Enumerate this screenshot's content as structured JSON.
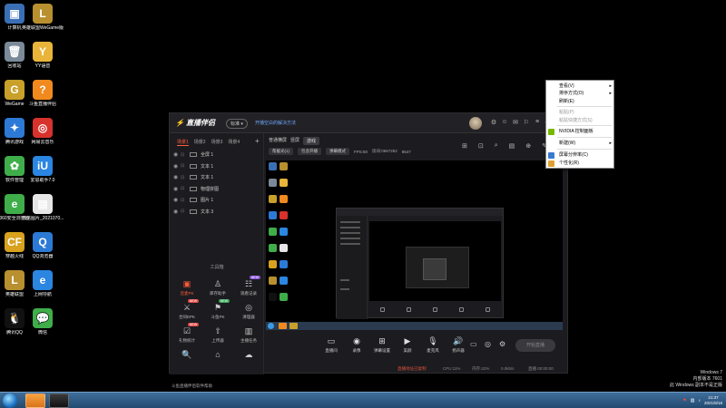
{
  "desktop": {
    "icons": [
      {
        "label": "计算机",
        "color": "#3b6fb5",
        "glyph": "▣"
      },
      {
        "label": "英雄联盟WeGame版",
        "color": "#b8902f",
        "glyph": "L"
      },
      {
        "label": "回收站",
        "color": "#7a8a99",
        "glyph": "🗑"
      },
      {
        "label": "YY语音",
        "color": "#e8b43a",
        "glyph": "Y"
      },
      {
        "label": "WeGame",
        "color": "#c8a02a",
        "glyph": "G"
      },
      {
        "label": "斗鱼直播伴侣",
        "color": "#f08a1e",
        "glyph": "?"
      },
      {
        "label": "腾讯游戏",
        "color": "#2d7ad6",
        "glyph": "✦"
      },
      {
        "label": "网易云音乐",
        "color": "#d8322c",
        "glyph": "◎"
      },
      {
        "label": "软件管理",
        "color": "#3fae4a",
        "glyph": "✿"
      },
      {
        "label": "爱思助手7.0",
        "color": "#2a86e0",
        "glyph": "iU"
      },
      {
        "label": "360安全浏览器",
        "color": "#3fae4a",
        "glyph": "e"
      },
      {
        "label": "微信图片_2021070...",
        "color": "#e6e6e6",
        "glyph": "▤"
      },
      {
        "label": "穿越火线",
        "color": "#d8a21e",
        "glyph": "CF"
      },
      {
        "label": "QQ浏览器",
        "color": "#2d7ad6",
        "glyph": "Q"
      },
      {
        "label": "英雄联盟",
        "color": "#b8902f",
        "glyph": "L"
      },
      {
        "label": "上网导航",
        "color": "#2a86e0",
        "glyph": "e"
      },
      {
        "label": "腾讯QQ",
        "color": "#111111",
        "glyph": "🐧"
      },
      {
        "label": "微信",
        "color": "#3fae4a",
        "glyph": "💬"
      }
    ]
  },
  "app": {
    "logo": "直播伴侣",
    "version": "标准 ▾",
    "notice": "开播空白的解决方法",
    "title_buttons": [
      "⚙",
      "☺",
      "✉",
      "⚐",
      "≡",
      "—",
      "✕"
    ],
    "scene_tabs": [
      "场景1",
      "场景2",
      "场景3",
      "场景4"
    ],
    "scene_add": "+",
    "sources": [
      {
        "name": "全屏 1"
      },
      {
        "name": "文本 1"
      },
      {
        "name": "文本 1"
      },
      {
        "name": "物理拼图"
      },
      {
        "name": "图片 1"
      },
      {
        "name": "文本 3"
      }
    ],
    "tools_title": "工具箱",
    "tools": [
      {
        "label": "连麦PK",
        "glyph": "▣",
        "hot": true,
        "badge": ""
      },
      {
        "label": "库存助手",
        "glyph": "♙",
        "hot": false,
        "badge": ""
      },
      {
        "label": "观看记录",
        "glyph": "☷",
        "hot": false,
        "badge": "NEW"
      },
      {
        "label": "合同EPK",
        "glyph": "⚔",
        "hot": false,
        "badge": "NEW"
      },
      {
        "label": "斗鱼PK",
        "glyph": "⚑",
        "hot": false,
        "badge": "NEW"
      },
      {
        "label": "清理器",
        "glyph": "◎",
        "hot": false,
        "badge": ""
      },
      {
        "label": "礼物统计",
        "glyph": "☑",
        "hot": false,
        "badge": "NEW"
      },
      {
        "label": "上传器",
        "glyph": "⇧",
        "hot": false,
        "badge": ""
      },
      {
        "label": "主播任务",
        "glyph": "▥",
        "hot": false,
        "badge": ""
      },
      {
        "label": "",
        "glyph": "🔍",
        "hot": false,
        "badge": ""
      },
      {
        "label": "",
        "glyph": "⌂",
        "hot": false,
        "badge": ""
      },
      {
        "label": "",
        "glyph": "☁",
        "hot": false,
        "badge": ""
      }
    ],
    "footer_hint": "斗鱼直播伴侣软件帮助",
    "mode_tabs": [
      "普通横屏",
      "竖屏",
      "游戏"
    ],
    "subrow": {
      "btn1": "帮截光(1)",
      "btn2": "包含开播",
      "btn3": "弹幕模式",
      "fps": "FPS:60",
      "room": "房间:0667252",
      "count": "8647"
    },
    "head_icons": [
      "⊞",
      "⊡",
      "⌕",
      "▤",
      "⊕",
      "✎"
    ],
    "bottom_tools": [
      {
        "label": "直播间",
        "glyph": "▭"
      },
      {
        "label": "录像",
        "glyph": "◉"
      },
      {
        "label": "弹幕设置",
        "glyph": "⊞"
      },
      {
        "label": "美颜",
        "glyph": "▶"
      },
      {
        "label": "麦克风",
        "glyph": "🎙"
      },
      {
        "label": "扬声器",
        "glyph": "🔊"
      }
    ],
    "bottom_extra": [
      "▭",
      "◎",
      "⚙"
    ],
    "start_live": "开始直播",
    "status": {
      "warn": "直播地址已复制",
      "cpu": "CPU:11%",
      "mem": "内存:42%",
      "net": "0.0kb/s",
      "dur": "直播 00:00:00"
    }
  },
  "context_menu": {
    "items": [
      {
        "label": "查看(V)",
        "arrow": "▸",
        "disabled": false,
        "icon": ""
      },
      {
        "label": "排序方式(O)",
        "arrow": "▸",
        "disabled": false,
        "icon": ""
      },
      {
        "label": "刷新(E)",
        "arrow": "",
        "disabled": false,
        "icon": ""
      },
      {
        "label": "粘贴(P)",
        "arrow": "",
        "disabled": true,
        "icon": ""
      },
      {
        "label": "粘贴快捷方式(S)",
        "arrow": "",
        "disabled": true,
        "icon": ""
      },
      {
        "label": "NVIDIA 控制面板",
        "arrow": "",
        "disabled": false,
        "icon": "#76b900"
      },
      {
        "label": "新建(W)",
        "arrow": "▸",
        "disabled": false,
        "icon": ""
      },
      {
        "label": "屏幕分辨率(C)",
        "arrow": "",
        "disabled": false,
        "icon": "#3b7ad0"
      },
      {
        "label": "个性化(R)",
        "arrow": "",
        "disabled": false,
        "icon": "#e0a030"
      }
    ]
  },
  "watermark": {
    "line1": "Windows 7",
    "line2": "内部版本 7601",
    "line3": "此 Windows 副本不是正版"
  },
  "taskbar": {
    "time": "21:37",
    "date": "2021/8/18"
  }
}
